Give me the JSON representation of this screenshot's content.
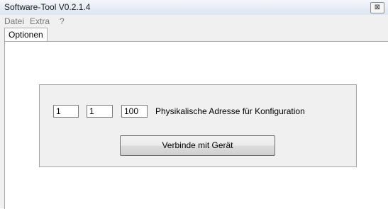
{
  "window": {
    "title": "Software-Tool V0.2.1.4",
    "close_glyph": "⊠"
  },
  "menu": {
    "items": [
      "Datei",
      "Extra",
      "?"
    ]
  },
  "tabs": [
    {
      "label": "Optionen"
    }
  ],
  "address": {
    "part1": "1",
    "part2": "1",
    "part3": "100",
    "label": "Physikalische Adresse für Konfiguration"
  },
  "connect_button": {
    "label": "Verbinde mit Gerät"
  }
}
